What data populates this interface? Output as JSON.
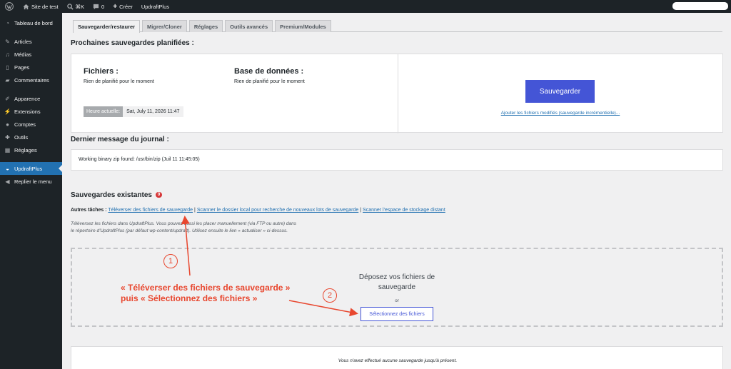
{
  "adminbar": {
    "site_name": "Site de test",
    "shortcut": "⌘K",
    "comments_count": "0",
    "new_label": "Créer",
    "plugin_label": "UpdraftPlus"
  },
  "sidebar": {
    "items": [
      {
        "label": "Tableau de bord",
        "icon": "dashboard-icon"
      },
      {
        "label": "Articles",
        "icon": "pin-icon"
      },
      {
        "label": "Médias",
        "icon": "media-icon"
      },
      {
        "label": "Pages",
        "icon": "page-icon"
      },
      {
        "label": "Commentaires",
        "icon": "comment-icon"
      },
      {
        "label": "Apparence",
        "icon": "brush-icon"
      },
      {
        "label": "Extensions",
        "icon": "plugin-icon"
      },
      {
        "label": "Comptes",
        "icon": "user-icon"
      },
      {
        "label": "Outils",
        "icon": "wrench-icon"
      },
      {
        "label": "Réglages",
        "icon": "settings-icon"
      },
      {
        "label": "UpdraftPlus",
        "icon": "updraft-icon"
      },
      {
        "label": "Replier le menu",
        "icon": "collapse-icon"
      }
    ]
  },
  "tabs": [
    "Sauvegarder/restaurer",
    "Migrer/Cloner",
    "Réglages",
    "Outils avancés",
    "Premium/Modules"
  ],
  "scheduled": {
    "heading": "Prochaines sauvegardes planifiées :",
    "files_title": "Fichiers :",
    "files_status": "Rien de planifié pour le moment",
    "db_title": "Base de données :",
    "db_status": "Rien de planifié pour le moment",
    "current_time_label": "Heure actuelle:",
    "current_time_value": "Sat, July 11, 2026 11:47",
    "backup_button": "Sauvegarder",
    "incremental_link": "Ajouter les fichiers modifiés (sauvegarde incrémentielle)..."
  },
  "journal": {
    "heading": "Dernier message du journal :",
    "message": "Working binary zip found: /usr/bin/zip (Juil 11 11:45:05)"
  },
  "existing": {
    "heading": "Sauvegardes existantes",
    "count": "0",
    "other_tasks_label": "Autres tâches :",
    "link_upload": "Téléverser des fichiers de sauvegarde",
    "link_scan_local": "Scanner le dossier local pour recherche de nouveaux lots de sauvegarde",
    "link_scan_remote": "Scanner l'espace de stockage distant",
    "separator": "|",
    "help_text": "Téléversez les fichiers dans UpdraftPlus. Vous pouvez aussi les placer manuellement (via FTP ou autre) dans le répertoire d'UpdraftPlus (par défaut wp-content/updraft). Utilisez ensuite le lien « actualiser » ci-dessus.",
    "drop_text": "Déposez vos fichiers de sauvegarde",
    "or_text": "or",
    "select_button": "Sélectionnez des fichiers",
    "no_backups": "Vous n'avez effectué aucune sauvegarde jusqu'à présent."
  },
  "annotation": {
    "step1": "1",
    "step2": "2",
    "line1": "« Téléverser des fichiers de sauvegarde »",
    "line2": "puis « Sélectionnez des fichiers »",
    "color": "#e8472f"
  }
}
